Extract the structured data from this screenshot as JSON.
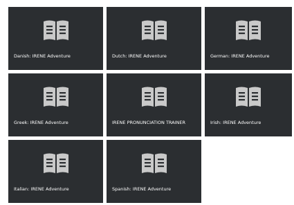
{
  "courses": [
    {
      "label": "Danish: IRENE Adventure",
      "icon": "book-icon"
    },
    {
      "label": "Dutch: IRENE Adventure",
      "icon": "book-icon"
    },
    {
      "label": "German: IRENE Adventure",
      "icon": "book-icon"
    },
    {
      "label": "Greek: IRENE Adventure",
      "icon": "book-icon"
    },
    {
      "label": "IRENE PRONUNCIATION TRAINER",
      "icon": "book-icon"
    },
    {
      "label": "Irish: IRENE Adventure",
      "icon": "book-icon"
    },
    {
      "label": "Italian: IRENE Adventure",
      "icon": "book-icon"
    },
    {
      "label": "Spanish: IRENE Adventure",
      "icon": "book-icon"
    }
  ],
  "colors": {
    "tile_background": "#2b2e31",
    "icon_color": "#c9c9c9",
    "label_color": "#ffffff",
    "page_background": "#ffffff"
  }
}
